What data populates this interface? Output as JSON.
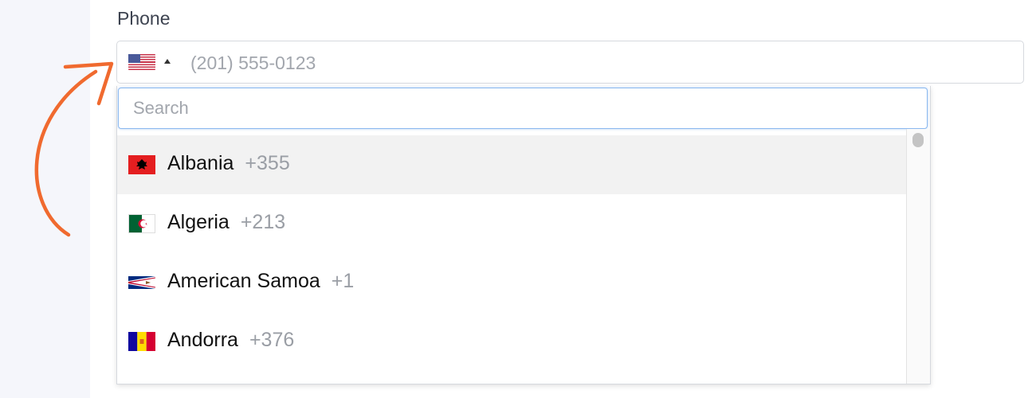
{
  "form": {
    "label": "Phone",
    "phone_placeholder": "(201) 555-0123",
    "selected_country_flag": "flag-us-icon"
  },
  "dropdown": {
    "search_placeholder": "Search",
    "countries": [
      {
        "name": "Albania",
        "code": "+355",
        "flag": "flag-albania-icon",
        "highlighted": true
      },
      {
        "name": "Algeria",
        "code": "+213",
        "flag": "flag-algeria-icon",
        "highlighted": false
      },
      {
        "name": "American Samoa",
        "code": "+1",
        "flag": "flag-american-samoa-icon",
        "highlighted": false
      },
      {
        "name": "Andorra",
        "code": "+376",
        "flag": "flag-andorra-icon",
        "highlighted": false
      }
    ]
  },
  "colors": {
    "annotation_arrow": "#f06a2f",
    "focus_border": "#8ab8ef",
    "highlight_row": "#f2f2f2"
  }
}
